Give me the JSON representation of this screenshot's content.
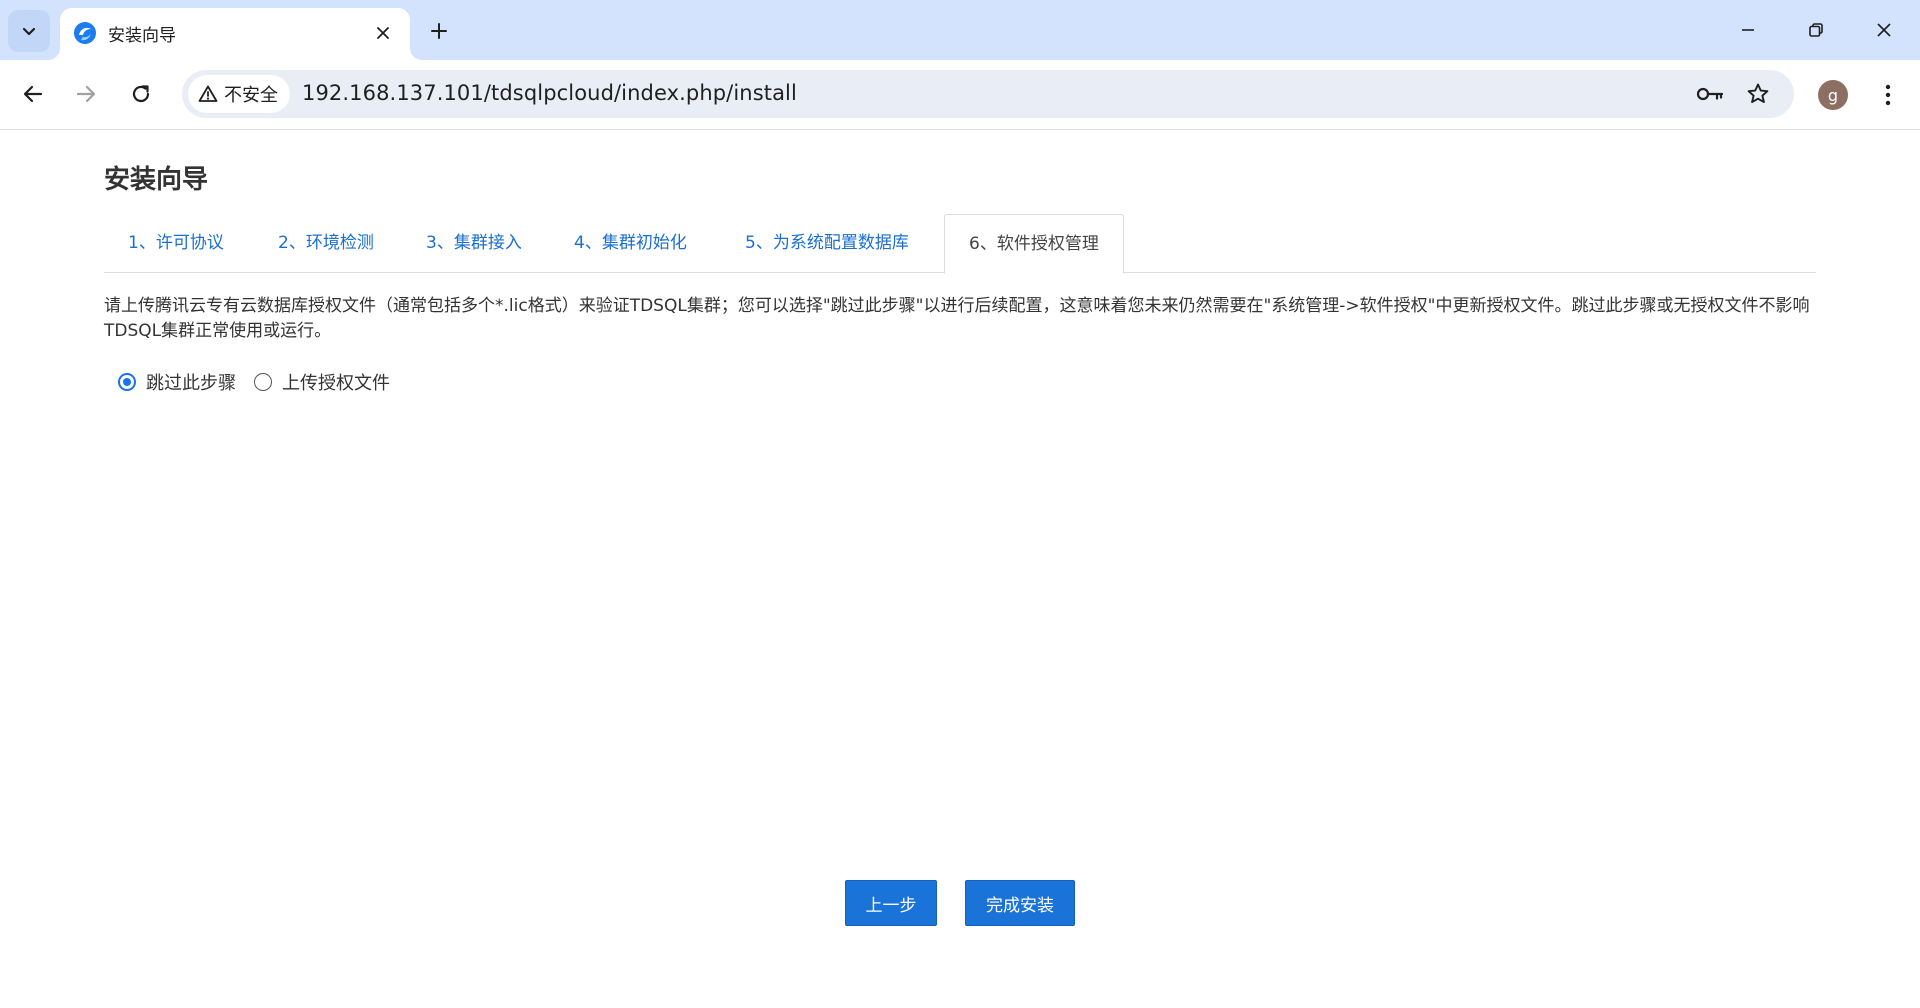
{
  "browser": {
    "tab_title": "安装向导",
    "security_label": "不安全",
    "url": "192.168.137.101/tdsqlpcloud/index.php/install",
    "profile_initial": "g"
  },
  "page": {
    "title": "安装向导",
    "steps": [
      {
        "label": "1、许可协议",
        "active": false
      },
      {
        "label": "2、环境检测",
        "active": false
      },
      {
        "label": "3、集群接入",
        "active": false
      },
      {
        "label": "4、集群初始化",
        "active": false
      },
      {
        "label": "5、为系统配置数据库",
        "active": false
      },
      {
        "label": "6、软件授权管理",
        "active": true
      }
    ],
    "description": "请上传腾讯云专有云数据库授权文件（通常包括多个*.lic格式）来验证TDSQL集群；您可以选择\"跳过此步骤\"以进行后续配置，这意味着您未来仍然需要在\"系统管理->软件授权\"中更新授权文件。跳过此步骤或无授权文件不影响TDSQL集群正常使用或运行。",
    "radio_options": [
      {
        "label": "跳过此步骤",
        "checked": true
      },
      {
        "label": "上传授权文件",
        "checked": false
      }
    ],
    "buttons": {
      "prev": "上一步",
      "finish": "完成安装"
    }
  },
  "colors": {
    "accent": "#1a73d9",
    "link": "#1a6fd0",
    "chrome_tabbar": "#d3e3fd",
    "omnibox": "#e9eef6"
  },
  "icons": [
    "chevron-down-icon",
    "tencent-cloud-favicon",
    "close-icon",
    "plus-icon",
    "minimize-icon",
    "restore-icon",
    "window-close-icon",
    "back-arrow-icon",
    "forward-arrow-icon",
    "reload-icon",
    "warning-icon",
    "key-icon",
    "star-icon",
    "kebab-menu-icon"
  ]
}
